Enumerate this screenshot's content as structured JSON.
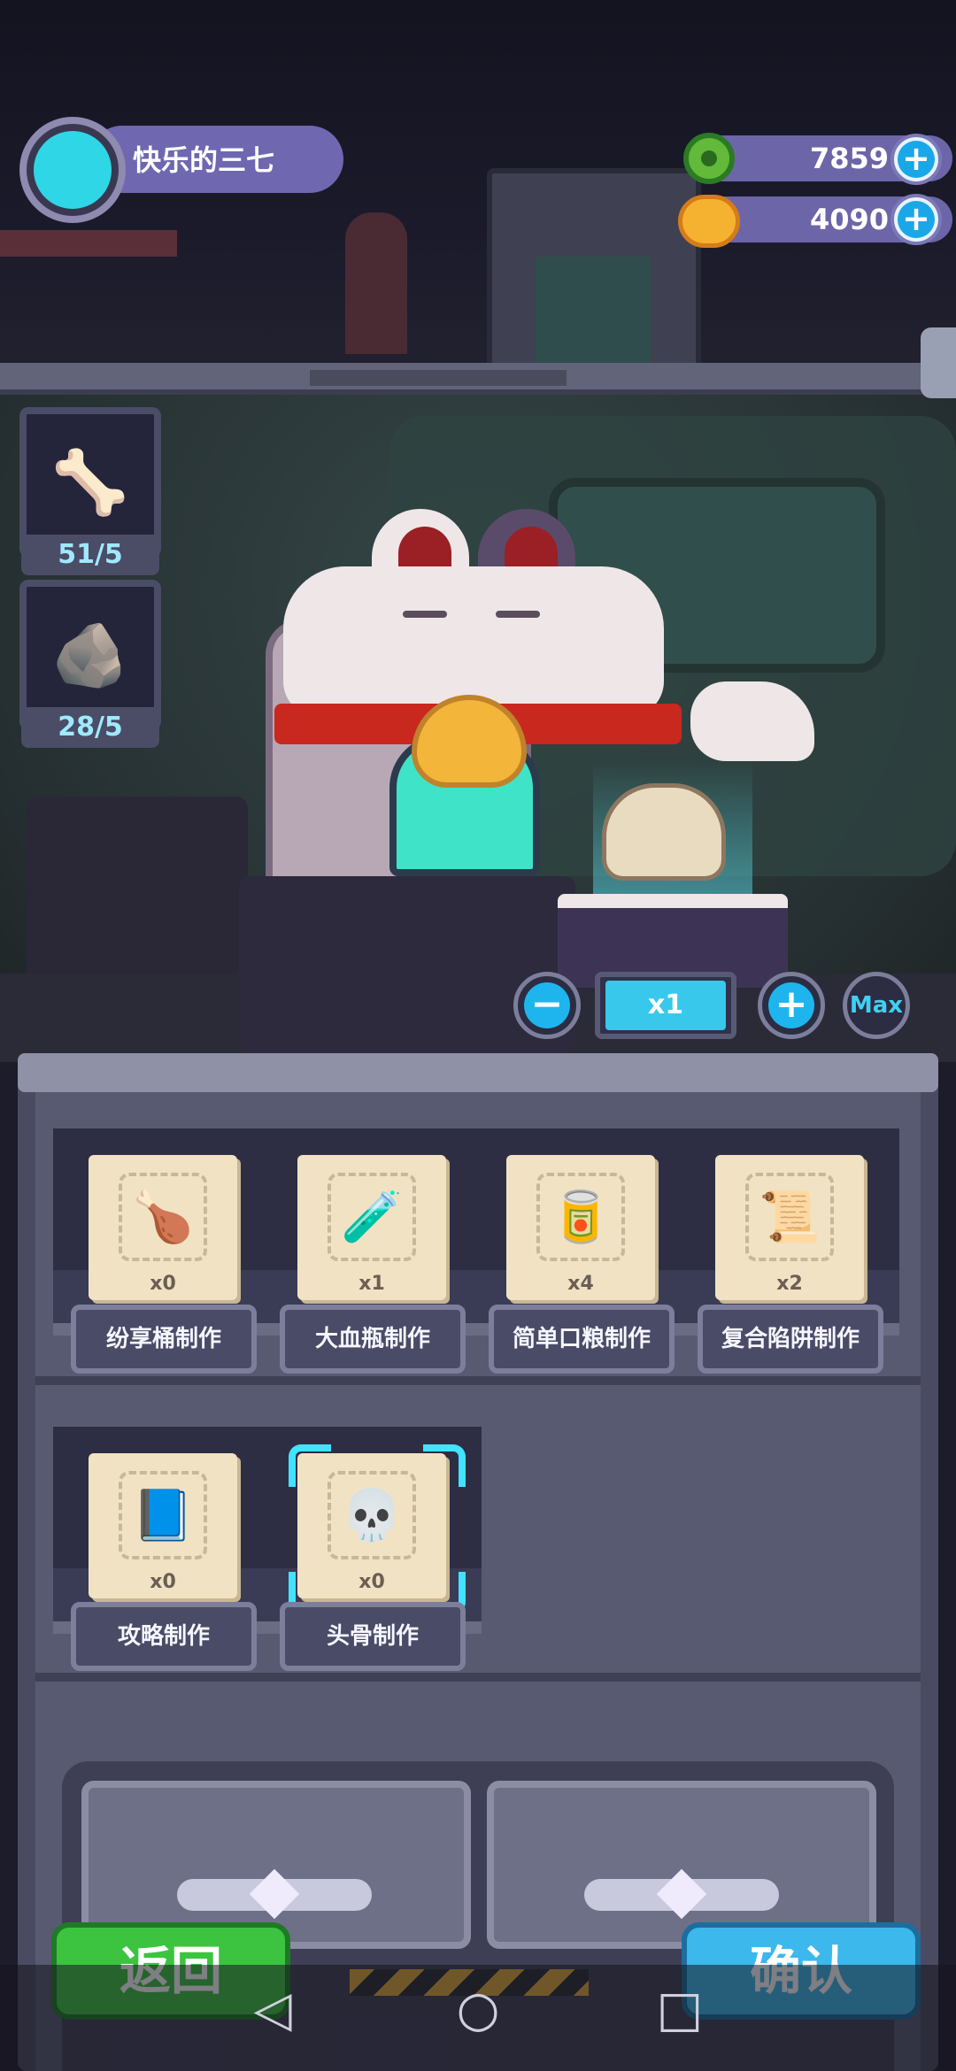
{
  "header": {
    "player_name": "快乐的三七",
    "currency1": "7859",
    "currency2": "4090"
  },
  "materials": [
    {
      "name": "bone",
      "count": "51/5"
    },
    {
      "name": "rock",
      "count": "28/5"
    }
  ],
  "quantity": {
    "value": "x1",
    "max_label": "Max"
  },
  "recipes_row1": [
    {
      "label": "纷享桶制作",
      "count": "x0",
      "icon": "🍗"
    },
    {
      "label": "大血瓶制作",
      "count": "x1",
      "icon": "🧪"
    },
    {
      "label": "简单口粮制作",
      "count": "x4",
      "icon": "🥫"
    },
    {
      "label": "复合陷阱制作",
      "count": "x2",
      "icon": "📜"
    }
  ],
  "recipes_row2": [
    {
      "label": "攻略制作",
      "count": "x0",
      "icon": "📘"
    },
    {
      "label": "头骨制作",
      "count": "x0",
      "icon": "💀",
      "selected": true
    }
  ],
  "buttons": {
    "back": "返回",
    "confirm": "确认"
  },
  "nav": {
    "back_icon": "◁",
    "home_icon": "○",
    "recents_icon": "□"
  },
  "colors": {
    "accent": "#1eb5ef",
    "back_button": "#3cc440",
    "confirm_button": "#3cb8ec",
    "selection": "#43e2ff"
  }
}
